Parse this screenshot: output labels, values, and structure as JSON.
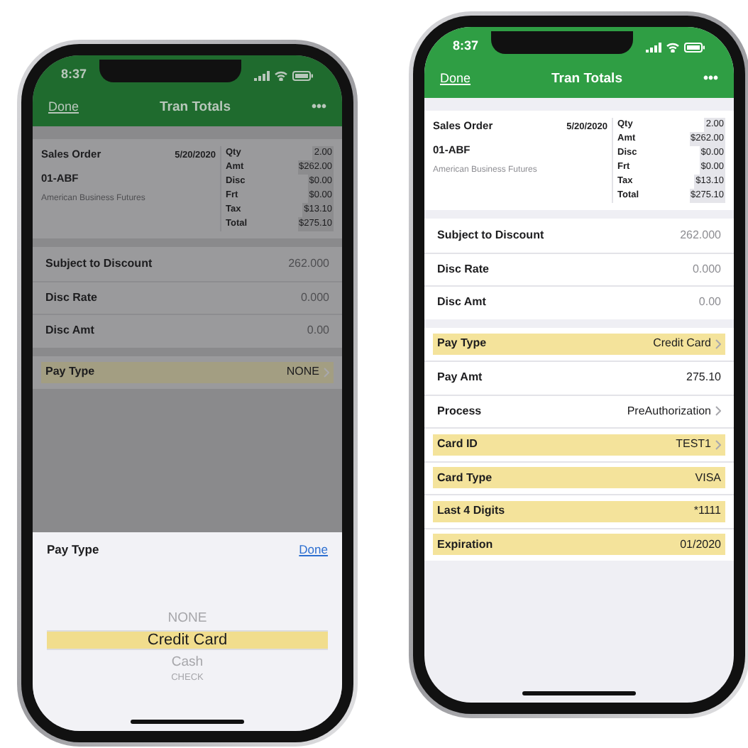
{
  "phones": [
    {
      "dimmed": true,
      "time": "8:37",
      "nav": {
        "left": "Done",
        "title": "Tran Totals",
        "right": "•••"
      },
      "summary": {
        "title": "Sales Order",
        "date": "5/20/2020",
        "number": "01-ABF",
        "company": "American Business Futures",
        "totals": [
          {
            "label": "Qty",
            "value": "2.00"
          },
          {
            "label": "Amt",
            "value": "$262.00"
          },
          {
            "label": "Disc",
            "value": "$0.00"
          },
          {
            "label": "Frt",
            "value": "$0.00"
          },
          {
            "label": "Tax",
            "value": "$13.10"
          },
          {
            "label": "Total",
            "value": "$275.10"
          }
        ]
      },
      "sections": [
        [
          {
            "label": "Subject to Discount",
            "value": "262.000",
            "muted": true,
            "highlighted": false,
            "chevron": false
          },
          {
            "label": "Disc Rate",
            "value": "0.000",
            "muted": true,
            "highlighted": false,
            "chevron": false
          },
          {
            "label": "Disc Amt",
            "value": "0.00",
            "muted": true,
            "highlighted": false,
            "chevron": false
          }
        ],
        [
          {
            "label": "Pay Type",
            "value": "NONE",
            "muted": false,
            "highlighted": true,
            "chevron": true
          }
        ]
      ],
      "picker": {
        "title": "Pay Type",
        "done": "Done",
        "options": [
          {
            "label": "NONE",
            "selected": false
          },
          {
            "label": "Credit Card",
            "selected": true
          },
          {
            "label": "Cash",
            "selected": false
          },
          {
            "label": "CHECK",
            "selected": false
          }
        ]
      }
    },
    {
      "dimmed": false,
      "time": "8:37",
      "nav": {
        "left": "Done",
        "title": "Tran Totals",
        "right": "•••"
      },
      "summary": {
        "title": "Sales Order",
        "date": "5/20/2020",
        "number": "01-ABF",
        "company": "American Business Futures",
        "totals": [
          {
            "label": "Qty",
            "value": "2.00"
          },
          {
            "label": "Amt",
            "value": "$262.00"
          },
          {
            "label": "Disc",
            "value": "$0.00"
          },
          {
            "label": "Frt",
            "value": "$0.00"
          },
          {
            "label": "Tax",
            "value": "$13.10"
          },
          {
            "label": "Total",
            "value": "$275.10"
          }
        ]
      },
      "sections": [
        [
          {
            "label": "Subject to Discount",
            "value": "262.000",
            "muted": true,
            "highlighted": false,
            "chevron": false
          },
          {
            "label": "Disc Rate",
            "value": "0.000",
            "muted": true,
            "highlighted": false,
            "chevron": false
          },
          {
            "label": "Disc Amt",
            "value": "0.00",
            "muted": true,
            "highlighted": false,
            "chevron": false
          }
        ],
        [
          {
            "label": "Pay Type",
            "value": "Credit Card",
            "muted": false,
            "highlighted": true,
            "chevron": true
          },
          {
            "label": "Pay Amt",
            "value": "275.10",
            "muted": false,
            "highlighted": false,
            "chevron": false
          },
          {
            "label": "Process",
            "value": "PreAuthorization",
            "muted": false,
            "highlighted": false,
            "chevron": true
          },
          {
            "label": "Card ID",
            "value": "TEST1",
            "muted": false,
            "highlighted": true,
            "chevron": true
          },
          {
            "label": "Card Type",
            "value": "VISA",
            "muted": false,
            "highlighted": true,
            "chevron": false
          },
          {
            "label": "Last 4 Digits",
            "value": "*1111",
            "muted": false,
            "highlighted": true,
            "chevron": false
          },
          {
            "label": "Expiration",
            "value": "01/2020",
            "muted": false,
            "highlighted": true,
            "chevron": false
          }
        ]
      ]
    }
  ]
}
